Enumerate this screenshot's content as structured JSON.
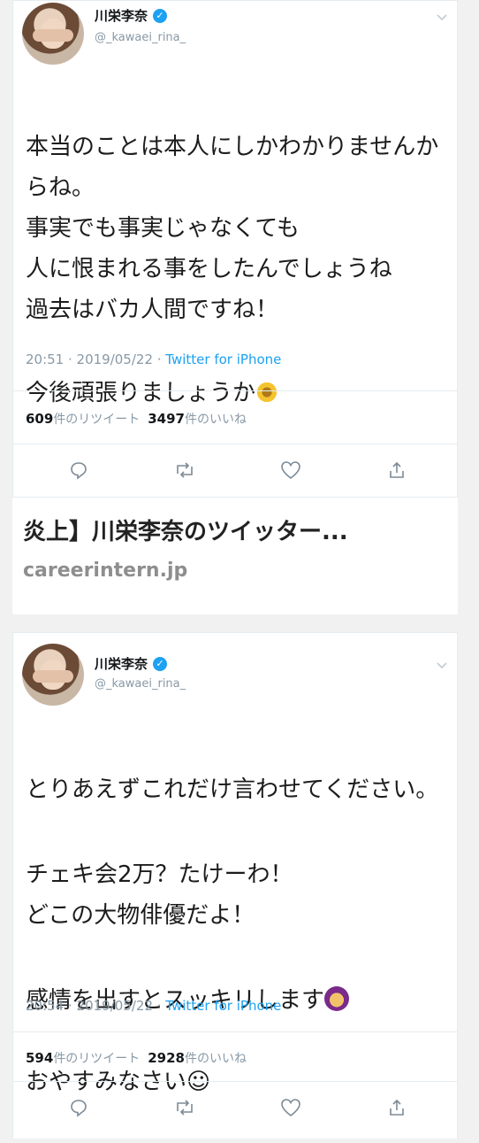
{
  "card1": {
    "tweet": {
      "name": "川栄李奈",
      "handle": "@_kawaei_rina_",
      "paragraphs": [
        "本当のことは本人にしかわかりませんからね。\n事実でも事実じゃなくても\n人に恨まれる事をしたんでしょうね\n過去はバカ人間ですね！",
        "今後頑張りましょうか"
      ],
      "emoji": "sunflower-emoji",
      "time": "20:51 · 2019/05/22 · ",
      "source": "Twitter for iPhone",
      "retweets": "609",
      "retweets_label": "件のリツイート",
      "likes": "3497",
      "likes_label": "件のいいね"
    },
    "caption": "炎上】川栄李奈のツイッター...",
    "domain": "careerintern.jp"
  },
  "card2": {
    "tweet": {
      "name": "川栄李奈",
      "handle": "@_kawaei_rina_",
      "paragraphs": [
        "とりあえずこれだけ言わせてください。",
        "チェキ会2万？たけーわ！\nどこの大物俳優だよ！",
        "感情を出すとスッキリします",
        "おやすみなさい☺"
      ],
      "emoji": "praying-face-emoji",
      "time": "20:54 · 2019/05/22 · ",
      "source": "Twitter for iPhone",
      "retweets": "594",
      "retweets_label": "件のリツイート",
      "likes": "2928",
      "likes_label": "件のいいね"
    }
  },
  "icons": {
    "reply": "reply-icon",
    "retweet": "retweet-icon",
    "like": "heart-icon",
    "share": "share-icon",
    "verified": "verified-badge-icon",
    "menu": "chevron-down-icon"
  },
  "colors": {
    "accent": "#1da1f2",
    "muted": "#8899a6",
    "background": "#f1f1f1"
  }
}
